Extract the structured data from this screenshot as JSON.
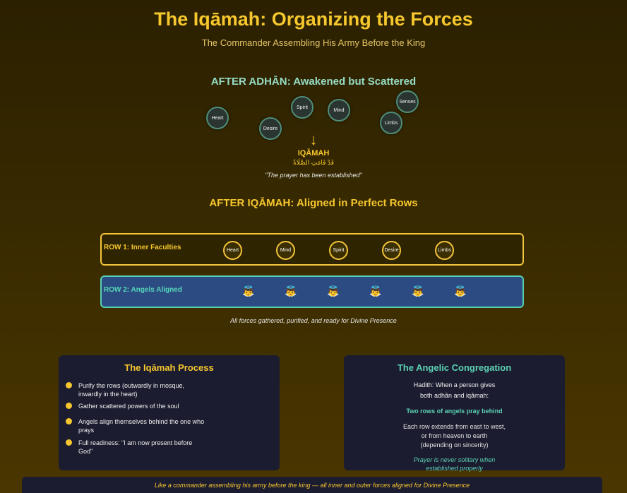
{
  "title": "The Iqāmah: Organizing the Forces",
  "subtitle": "The Commander Assembling His Army Before the King",
  "scattered": {
    "heading": "AFTER ADHĀN: Awakened but Scattered",
    "nodes": [
      "Heart",
      "Desire",
      "Spirit",
      "Mind",
      "Limbs",
      "Senses"
    ]
  },
  "transition": {
    "arrow": "↓",
    "label": "IQĀMAH",
    "arabic": "قَدْ قَامَتِ الصَّلَاةُ",
    "translation": "\"The prayer has been established\""
  },
  "aligned": {
    "heading": "AFTER IQĀMAH: Aligned in Perfect Rows",
    "row1": {
      "label": "ROW 1: Inner Faculties",
      "items": [
        "Heart",
        "Mind",
        "Spirit",
        "Desire",
        "Limbs"
      ]
    },
    "row2": {
      "label": "ROW 2: Angels Aligned",
      "angel_glyph": "👼",
      "angel_count": 6
    },
    "caption": "All forces gathered, purified, and ready for Divine Presence"
  },
  "process_panel": {
    "title": "The Iqāmah Process",
    "steps": [
      "Purify the rows (outwardly in mosque, inwardly in the heart)",
      "Gather scattered powers of the soul",
      "Angels align themselves behind the one who prays",
      "Full readiness: \"I am now present before God\""
    ]
  },
  "angelic_panel": {
    "title": "The Angelic Congregation",
    "hadith_line1": "Hadith: When a person gives",
    "hadith_line2": "both adhān and iqāmah:",
    "highlight": "Two rows of angels pray behind",
    "detail_line1": "Each row extends from east to west,",
    "detail_line2": "or from heaven to earth",
    "detail_line3": "(depending on sincerity)",
    "note_line1": "Prayer is never solitary when",
    "note_line2": "established properly"
  },
  "footer": "Like a commander assembling his army before the king — all inner and outer forces aligned for Divine Presence",
  "colors": {
    "gold": "#f6c72e",
    "teal": "#56cfb0",
    "panel_bg": "#1c1c30",
    "row2_bg": "#2c4b82"
  }
}
